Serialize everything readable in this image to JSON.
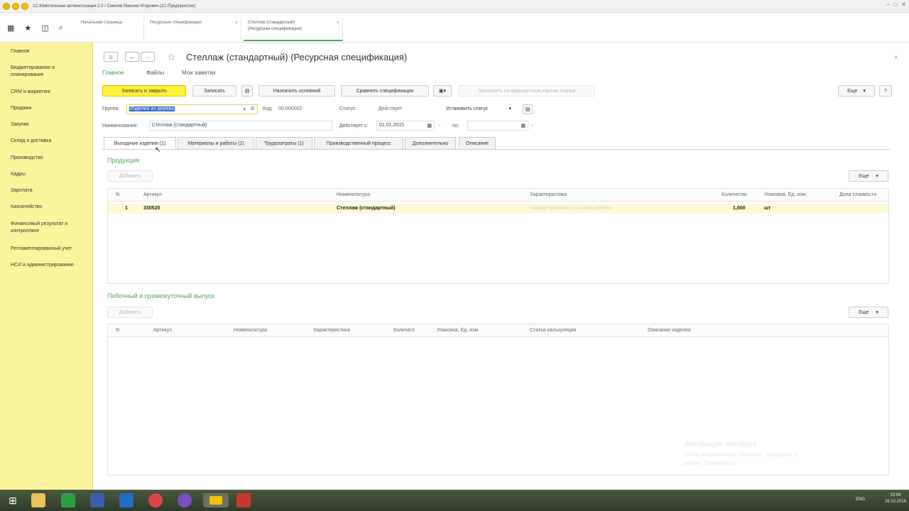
{
  "window": {
    "title": "1С:Комплексная автоматизация 2.0 / Смелов Максим Игоревич  (1С:Предприятие)"
  },
  "open_tabs": [
    {
      "label": "Начальная страница"
    },
    {
      "label": "Ресурсные спецификации"
    },
    {
      "label": "Стеллаж (стандартный)",
      "label2": "(Ресурсная спецификация)"
    }
  ],
  "sidebar": {
    "items": [
      {
        "label": "Главное"
      },
      {
        "label": "Бюджетирование и планирование"
      },
      {
        "label": "CRM и маркетинг"
      },
      {
        "label": "Продажи"
      },
      {
        "label": "Закупки"
      },
      {
        "label": "Склад и доставка"
      },
      {
        "label": "Производство"
      },
      {
        "label": "Кадры"
      },
      {
        "label": "Зарплата"
      },
      {
        "label": "Казначейство"
      },
      {
        "label": "Финансовый результат и контроллинг"
      },
      {
        "label": "Регламентированный учет"
      },
      {
        "label": "НСИ и администрирование"
      }
    ]
  },
  "form": {
    "title": "Стеллаж (стандартный) (Ресурсная спецификация)",
    "nav": {
      "main": "Главное",
      "files": "Файлы",
      "notes": "Мои заметки"
    },
    "toolbar": {
      "save_close": "Записать и закрыть",
      "save": "Записать",
      "set_main": "Назначить основной",
      "compare": "Сравнить спецификации",
      "fill_routes": "Заполнить по маршрутным картам этапов",
      "more": "Еще",
      "help": "?"
    },
    "fields": {
      "group_label": "Группа:",
      "group_value": "Изделия из дерева",
      "code_label": "Код:",
      "code_value": "00-000002",
      "status_label": "Статус:",
      "status_value": "Действует",
      "set_status": "Установить статус",
      "name_label": "Наименование:",
      "name_value": "Стеллаж (стандартный)",
      "valid_from_label": "Действует с:",
      "valid_from_value": "01.01.2015",
      "to_label": "по:",
      "to_value": ""
    },
    "tabs": [
      {
        "label": "Выходные изделия (1)"
      },
      {
        "label": "Материалы и работы (2)"
      },
      {
        "label": "Трудозатраты (1)"
      },
      {
        "label": "Производственный процесс"
      },
      {
        "label": "Дополнительно"
      },
      {
        "label": "Описание"
      }
    ],
    "products": {
      "title": "Продукция",
      "add": "Добавить",
      "more": "Еще",
      "columns": [
        "N",
        "Артикул",
        "Номенклатура",
        "Характеристика",
        "Количество",
        "Упаковка, Ед. изм.",
        "Доля стоимости"
      ],
      "rows": [
        {
          "n": "1",
          "article": "330520",
          "item": "Стеллаж (стандартный)",
          "characteristic": "<характеристики не используются>",
          "qty": "1,000",
          "unit": "шт",
          "share": ""
        }
      ]
    },
    "byproducts": {
      "title": "Побочный и промежуточный  выпуск",
      "add": "Добавить",
      "more": "Еще",
      "columns": [
        "N",
        "Артикул",
        "Номенклатура",
        "Характеристика",
        "Количество",
        "Упаковка, Ед. изм.",
        "Статья калькуляции",
        "Описание изделия"
      ]
    }
  },
  "watermark": {
    "line1": "Активация Windows",
    "line2": "Чтобы активировать Windows, перейдите в",
    "line3": "раздел \"Параметры\"."
  },
  "taskbar": {
    "lang": "ENG",
    "time": "13:04",
    "date": "29.10.2015"
  },
  "colors": {
    "sidebar_bg": "#fbf49c",
    "primary_button": "#fdf03a",
    "accent_green": "#4aa85c",
    "selection": "#3366cc"
  }
}
